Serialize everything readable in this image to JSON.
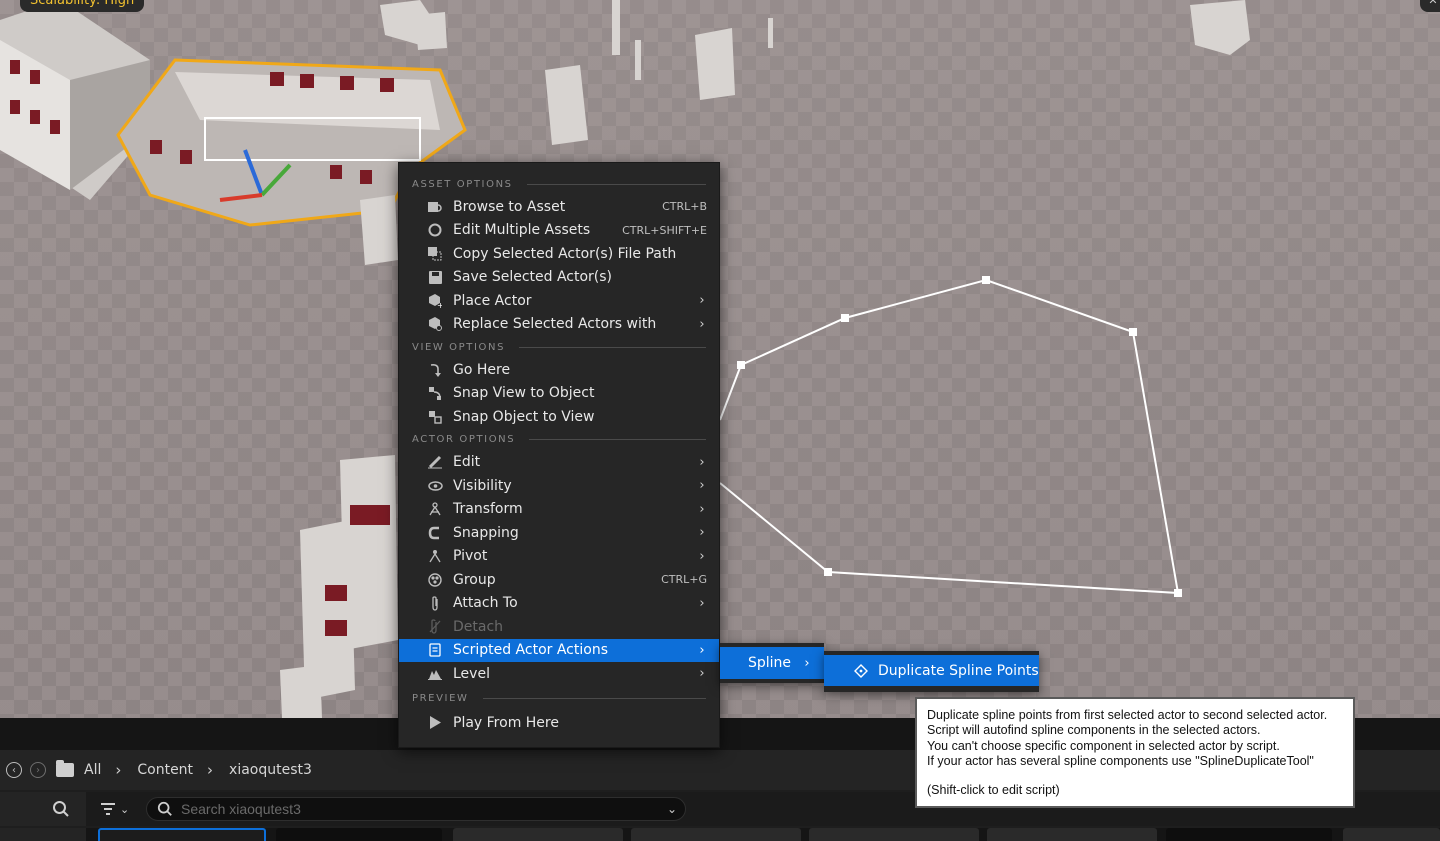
{
  "viewport": {
    "scalability_label": "Scalability: High"
  },
  "context_menu": {
    "sections": [
      {
        "header": "ASSET OPTIONS",
        "items": [
          {
            "label": "Browse to Asset",
            "shortcut": "CTRL+B",
            "icon": "browse-icon"
          },
          {
            "label": "Edit Multiple Assets",
            "shortcut": "CTRL+SHIFT+E",
            "icon": "circle-icon"
          },
          {
            "label": "Copy Selected Actor(s) File Path",
            "shortcut": "",
            "icon": "copy-path-icon"
          },
          {
            "label": "Save Selected Actor(s)",
            "shortcut": "",
            "icon": "save-icon"
          },
          {
            "label": "Place Actor",
            "shortcut": "",
            "icon": "place-actor-icon",
            "submenu": true
          },
          {
            "label": "Replace Selected Actors with",
            "shortcut": "",
            "icon": "replace-icon",
            "submenu": true
          }
        ]
      },
      {
        "header": "VIEW OPTIONS",
        "items": [
          {
            "label": "Go Here",
            "icon": "go-here-icon"
          },
          {
            "label": "Snap View to Object",
            "icon": "snap-view-icon"
          },
          {
            "label": "Snap Object to View",
            "icon": "snap-object-icon"
          }
        ]
      },
      {
        "header": "ACTOR OPTIONS",
        "items": [
          {
            "label": "Edit",
            "icon": "pencil-icon",
            "submenu": true
          },
          {
            "label": "Visibility",
            "icon": "eye-icon",
            "submenu": true
          },
          {
            "label": "Transform",
            "icon": "transform-icon",
            "submenu": true
          },
          {
            "label": "Snapping",
            "icon": "magnet-icon",
            "submenu": true
          },
          {
            "label": "Pivot",
            "icon": "pivot-icon",
            "submenu": true
          },
          {
            "label": "Group",
            "shortcut": "CTRL+G",
            "icon": "group-icon"
          },
          {
            "label": "Attach To",
            "icon": "paperclip-icon",
            "submenu": true
          },
          {
            "label": "Detach",
            "icon": "detach-icon",
            "disabled": true
          },
          {
            "label": "Scripted Actor Actions",
            "icon": "script-icon",
            "submenu": true,
            "active": true
          },
          {
            "label": "Level",
            "icon": "level-icon",
            "submenu": true
          }
        ]
      },
      {
        "header": "PREVIEW",
        "items": [
          {
            "label": "Play From Here",
            "icon": "play-icon"
          }
        ]
      }
    ]
  },
  "submenu_spline": {
    "label": "Spline"
  },
  "submenu_action": {
    "label": "Duplicate Spline Points",
    "icon": "diamond-icon"
  },
  "tooltip": {
    "lines": [
      "Duplicate spline points from first selected actor to second selected actor.",
      "Script will autofind spline components in the selected actors.",
      "You can't choose specific component in selected actor by script.",
      "If your actor has several spline components use \"SplineDuplicateTool\""
    ],
    "hint": "(Shift-click to edit script)"
  },
  "content_browser": {
    "breadcrumb": [
      "All",
      "Content",
      "xiaoqutest3"
    ],
    "search_placeholder": "Search xiaoqutest3"
  }
}
